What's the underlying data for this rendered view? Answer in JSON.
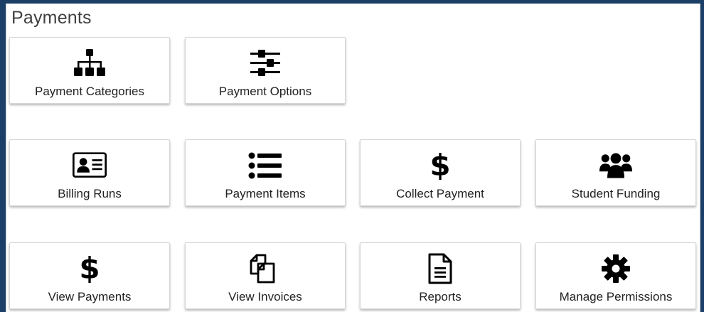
{
  "page": {
    "title": "Payments"
  },
  "tiles": [
    {
      "label": "Payment Categories",
      "icon": "sitemap-icon"
    },
    {
      "label": "Payment Options",
      "icon": "sliders-icon"
    },
    {
      "label": "Billing Runs",
      "icon": "id-card-icon"
    },
    {
      "label": "Payment Items",
      "icon": "list-icon"
    },
    {
      "label": "Collect Payment",
      "icon": "dollar-icon",
      "glyph": "$"
    },
    {
      "label": "Student Funding",
      "icon": "users-icon"
    },
    {
      "label": "View Payments",
      "icon": "dollar-icon",
      "glyph": "$"
    },
    {
      "label": "View Invoices",
      "icon": "copy-documents-icon"
    },
    {
      "label": "Reports",
      "icon": "document-icon"
    },
    {
      "label": "Manage Permissions",
      "icon": "gear-icon"
    }
  ],
  "colors": {
    "background": "#1b3f66",
    "panel": "#ffffff",
    "title_text": "#404040",
    "label_text": "#222222",
    "icon": "#000000"
  }
}
